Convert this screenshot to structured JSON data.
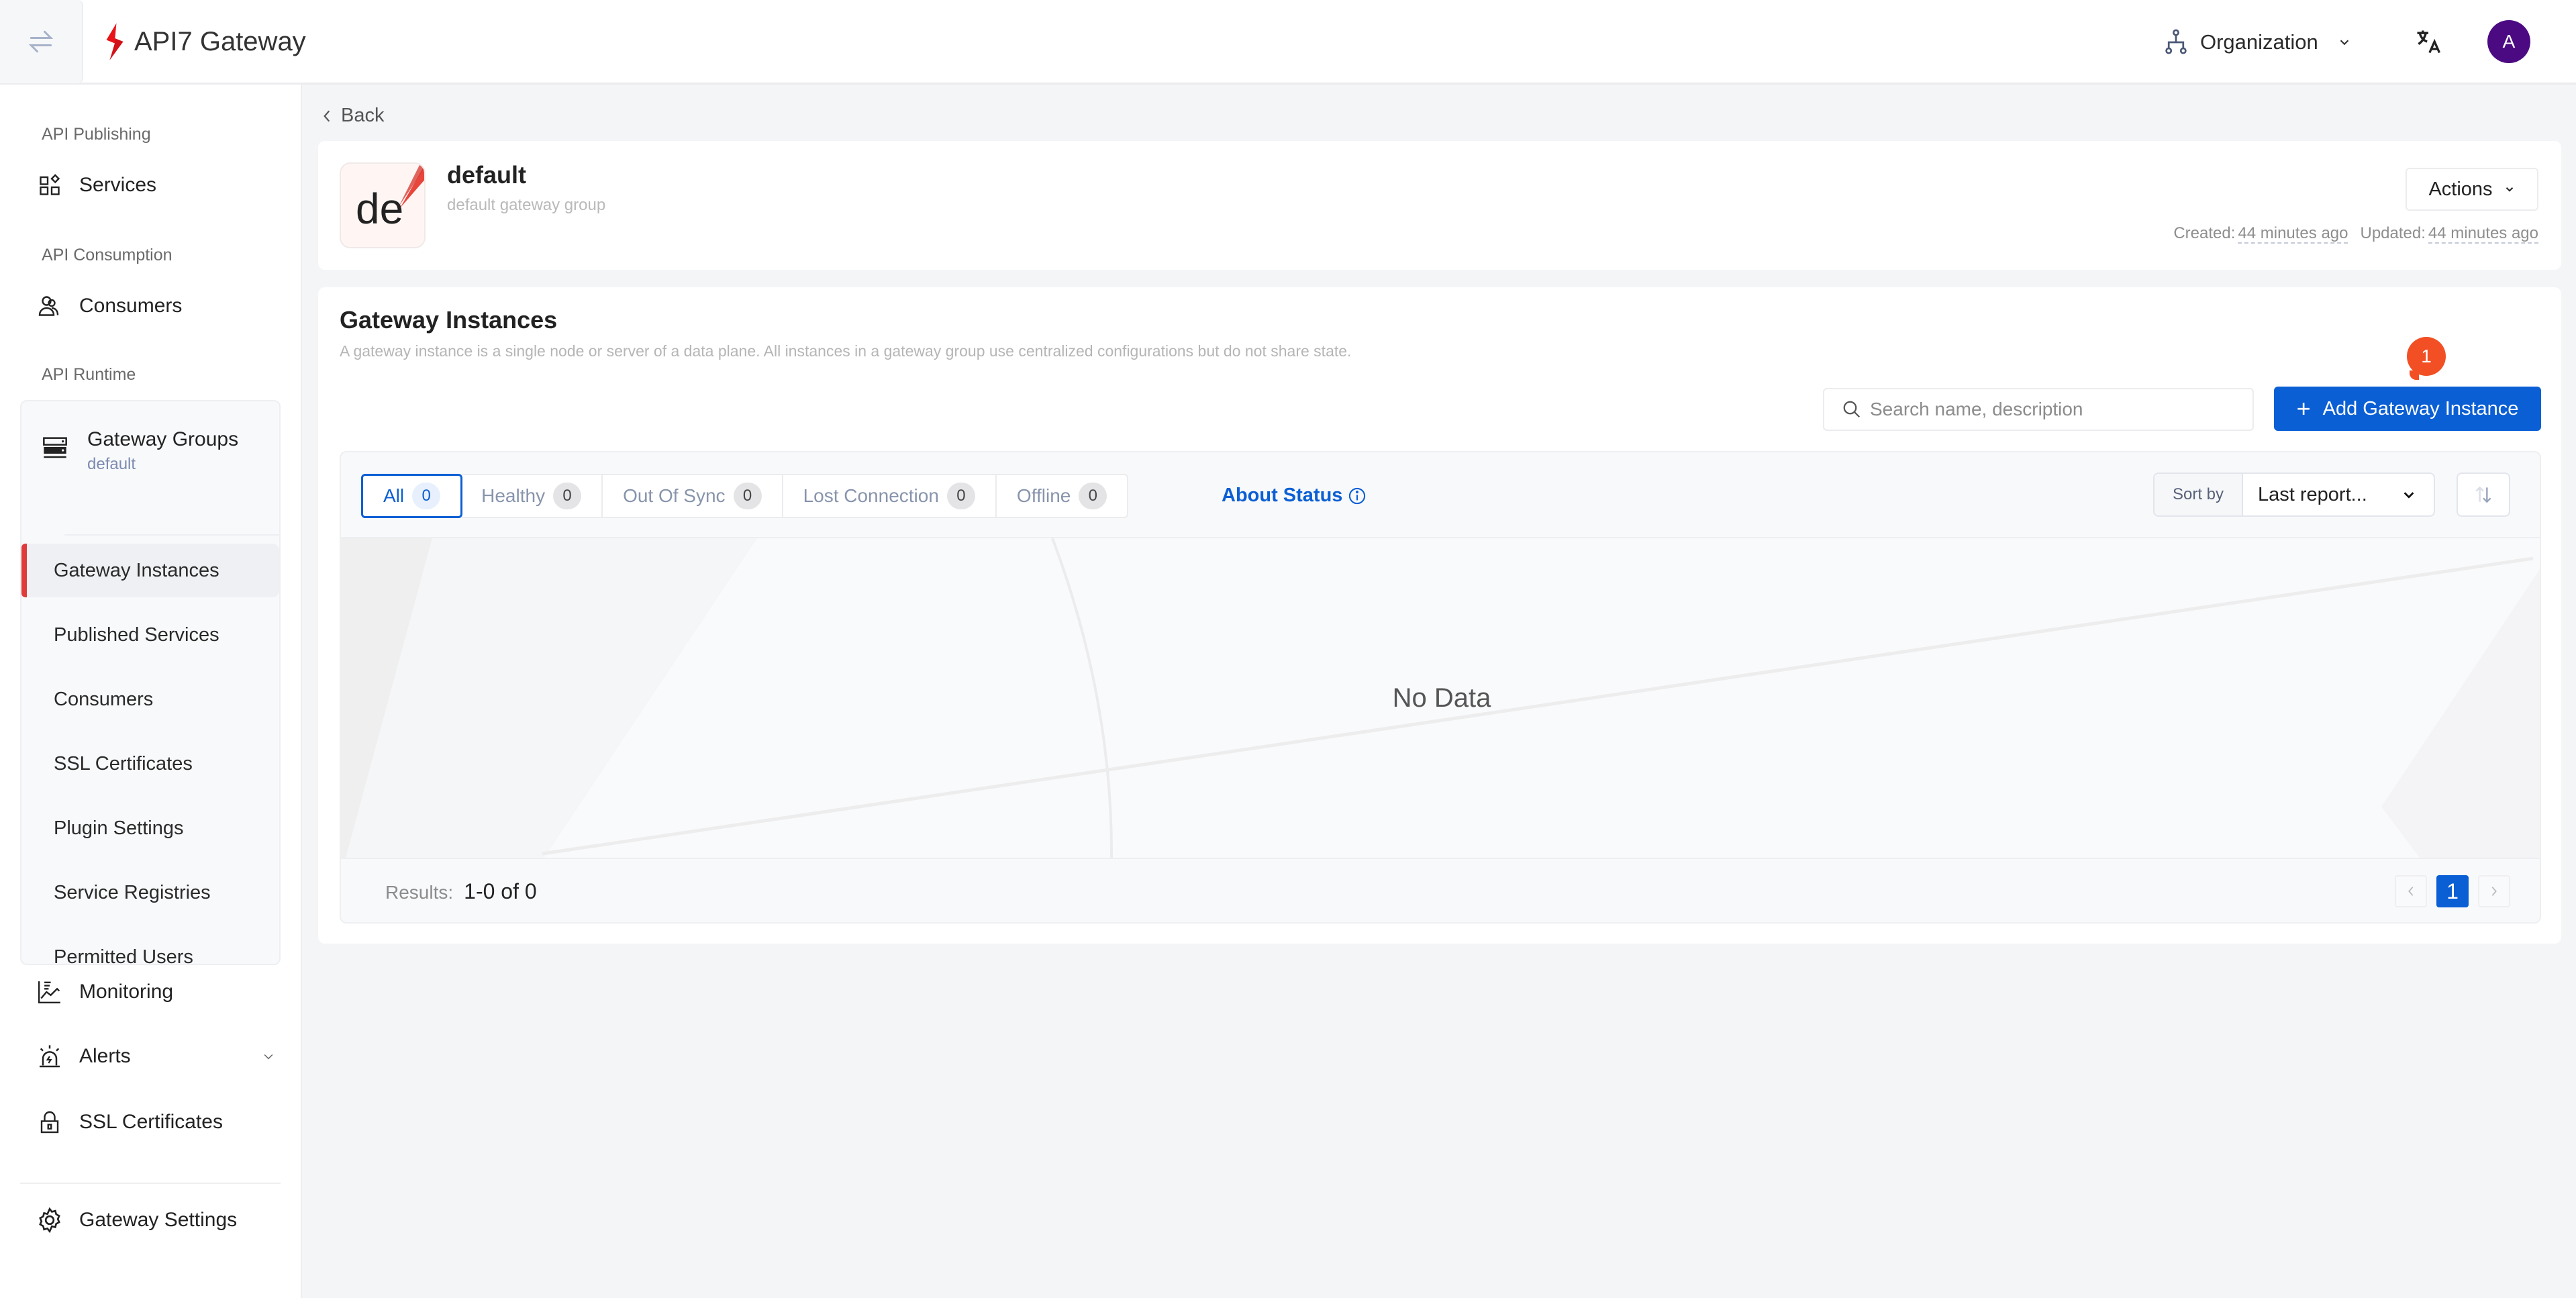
{
  "header": {
    "app_name": "API7 Gateway",
    "organization_label": "Organization",
    "avatar_initial": "A"
  },
  "sidebar": {
    "sections": {
      "publishing": "API Publishing",
      "consumption": "API Consumption",
      "runtime": "API Runtime"
    },
    "services": "Services",
    "consumers": "Consumers",
    "gateway_groups": {
      "label": "Gateway Groups",
      "selected": "default",
      "items": [
        {
          "label": "Gateway Instances",
          "active": true
        },
        {
          "label": "Published Services"
        },
        {
          "label": "Consumers"
        },
        {
          "label": "SSL Certificates"
        },
        {
          "label": "Plugin Settings"
        },
        {
          "label": "Service Registries"
        },
        {
          "label": "Permitted Users"
        }
      ]
    },
    "monitoring": "Monitoring",
    "alerts": "Alerts",
    "ssl_certificates": "SSL Certificates",
    "gateway_settings": "Gateway Settings"
  },
  "page": {
    "back_label": "Back",
    "group": {
      "logo_text": "de",
      "name": "default",
      "description": "default gateway group",
      "actions_label": "Actions",
      "created_label": "Created:",
      "created_value": "44 minutes ago",
      "updated_label": "Updated:",
      "updated_value": "44 minutes ago"
    },
    "instances": {
      "title": "Gateway Instances",
      "description": "A gateway instance is a single node or server of a data plane. All instances in a gateway group use centralized configurations but do not share state.",
      "search_placeholder": "Search name, description",
      "search_value": "",
      "add_button": "Add Gateway Instance",
      "step_badge": "1",
      "filters": [
        {
          "label": "All",
          "count": "0",
          "active": true
        },
        {
          "label": "Healthy",
          "count": "0"
        },
        {
          "label": "Out Of Sync",
          "count": "0"
        },
        {
          "label": "Lost Connection",
          "count": "0"
        },
        {
          "label": "Offline",
          "count": "0"
        }
      ],
      "about_status": "About Status",
      "sort_by_label": "Sort by",
      "sort_by_value": "Last report...",
      "empty_text": "No Data",
      "results_label": "Results:",
      "results_value": "1-0 of 0",
      "current_page": "1"
    }
  },
  "colors": {
    "primary": "#0b5fd4",
    "active_marker": "#e03a3a",
    "avatar": "#4b0a82",
    "step_badge": "#f24f24"
  }
}
